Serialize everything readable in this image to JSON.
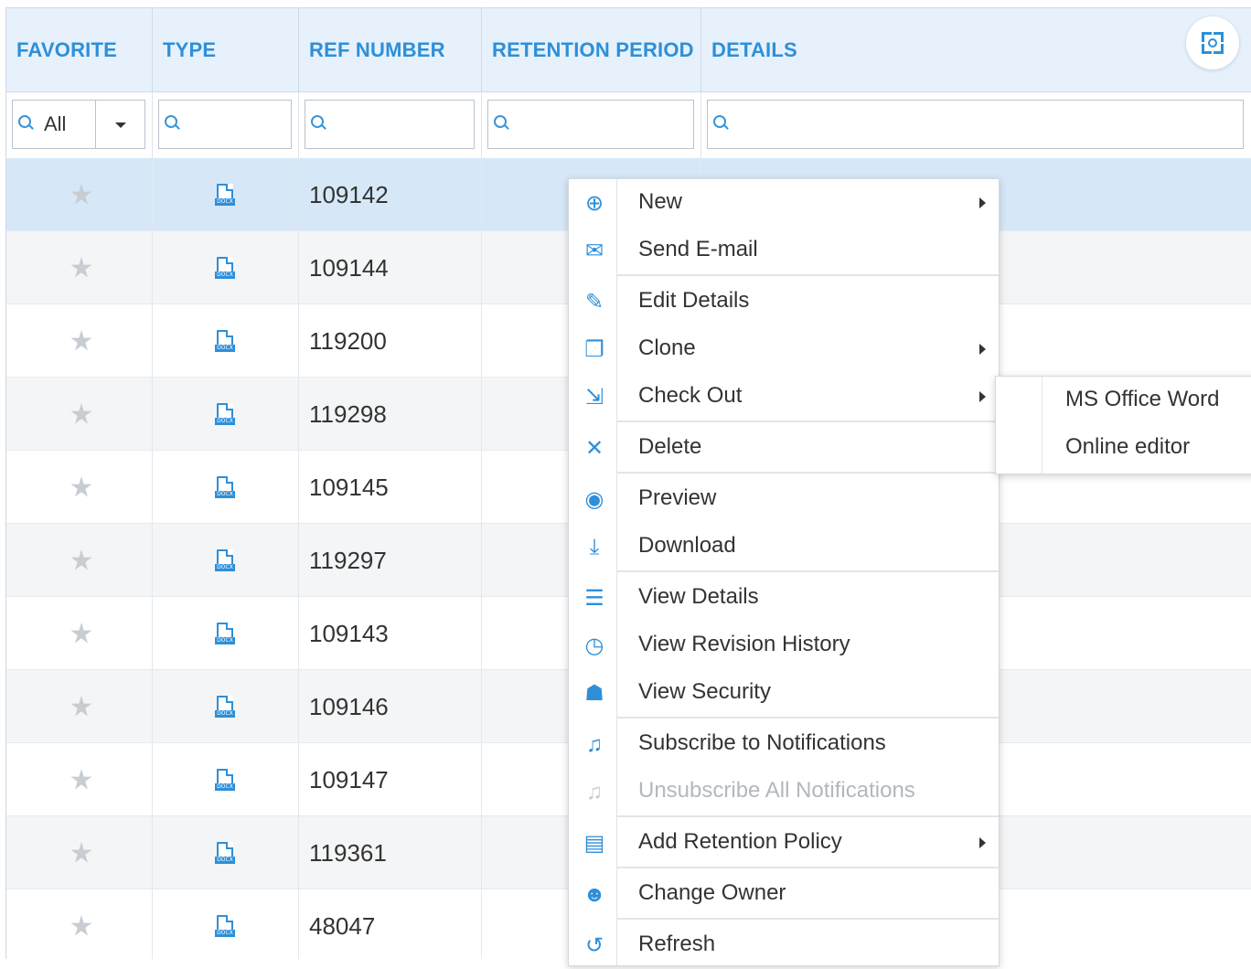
{
  "columns": [
    "FAVORITE",
    "TYPE",
    "REF NUMBER",
    "RETENTION PERIOD",
    "DETAILS"
  ],
  "filter": {
    "favorite_value": "All",
    "type_value": "",
    "ref_value": "",
    "retention_value": "",
    "details_value": ""
  },
  "rows": [
    {
      "ref": "109142",
      "type": "docx",
      "favorite": false,
      "selected": true
    },
    {
      "ref": "109144",
      "type": "docx",
      "favorite": false
    },
    {
      "ref": "119200",
      "type": "docx",
      "favorite": false
    },
    {
      "ref": "119298",
      "type": "docx",
      "favorite": false
    },
    {
      "ref": "109145",
      "type": "docx",
      "favorite": false
    },
    {
      "ref": "119297",
      "type": "docx",
      "favorite": false
    },
    {
      "ref": "109143",
      "type": "docx",
      "favorite": false
    },
    {
      "ref": "109146",
      "type": "docx",
      "favorite": false
    },
    {
      "ref": "109147",
      "type": "docx",
      "favorite": false
    },
    {
      "ref": "119361",
      "type": "docx",
      "favorite": false
    },
    {
      "ref": "48047",
      "type": "docx",
      "favorite": false
    }
  ],
  "context_menu": {
    "items": [
      {
        "label": "New",
        "icon": "plus-circle-icon",
        "submenu": true
      },
      {
        "label": "Send E-mail",
        "icon": "envelope-icon"
      },
      {
        "label": "Edit Details",
        "icon": "edit-document-icon"
      },
      {
        "label": "Clone",
        "icon": "clone-icon",
        "submenu": true
      },
      {
        "label": "Check Out",
        "icon": "check-out-icon",
        "submenu": true
      },
      {
        "label": "Delete",
        "icon": "delete-document-icon"
      },
      {
        "label": "Preview",
        "icon": "preview-icon"
      },
      {
        "label": "Download",
        "icon": "download-icon"
      },
      {
        "label": "View Details",
        "icon": "details-icon"
      },
      {
        "label": "View Revision History",
        "icon": "clock-icon"
      },
      {
        "label": "View Security",
        "icon": "user-lock-icon"
      },
      {
        "label": "Subscribe to Notifications",
        "icon": "bell-icon"
      },
      {
        "label": "Unsubscribe All Notifications",
        "icon": "bell-off-icon",
        "disabled": true
      },
      {
        "label": "Add Retention Policy",
        "icon": "retention-icon",
        "submenu": true
      },
      {
        "label": "Change Owner",
        "icon": "change-owner-icon"
      },
      {
        "label": "Refresh",
        "icon": "refresh-icon"
      }
    ]
  },
  "checkout_submenu": {
    "items": [
      "MS Office Word",
      "Online editor"
    ]
  },
  "colors": {
    "accent": "#2e8fd8",
    "header_bg": "#e6f1fb",
    "selected_row": "#d6e8f7"
  }
}
